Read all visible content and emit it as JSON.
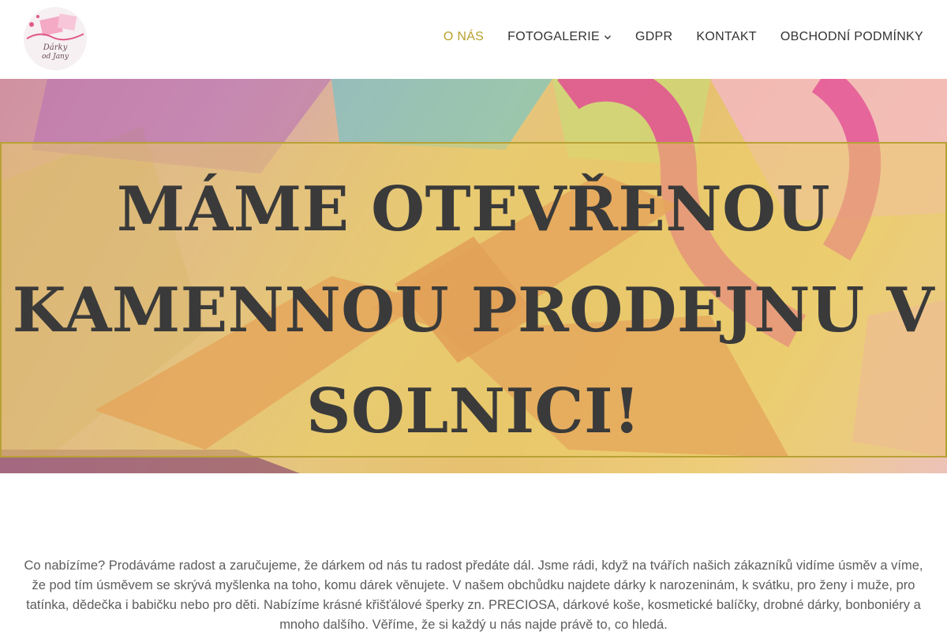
{
  "logo": {
    "line1": "Dárky",
    "line2": "od Jany"
  },
  "nav": {
    "items": [
      {
        "label": "O NÁS",
        "active": true
      },
      {
        "label": "FOTOGALERIE",
        "has_dropdown": true
      },
      {
        "label": "GDPR"
      },
      {
        "label": "KONTAKT"
      },
      {
        "label": "OBCHODNÍ PODMÍNKY"
      }
    ]
  },
  "hero": {
    "title": "MÁME OTEVŘENOU KAMENNOU PRODEJNU V SOLNICI!"
  },
  "content": {
    "paragraph": "Co nabízíme? Prodáváme radost a zaručujeme, že dárkem od nás tu radost předáte dál. Jsme rádi, když na tvářích našich zákazníků vidíme úsměv a víme, že pod tím úsměvem se skrývá myšlenka na toho, komu dárek věnujete. V našem obchůdku najdete dárky k narozeninám, k svátku, pro ženy i muže, pro tatínka, dědečka i babičku nebo pro děti. Nabízíme krásné křišťálové šperky zn. PRECIOSA, dárkové koše, kosmetické balíčky, drobné dárky, bonboniéry a mnoho dalšího. Věříme, že si každý u nás najde právě to, co hledá."
  },
  "colors": {
    "accent": "#b7a12d",
    "nav_text": "#333333",
    "hero_overlay": "#e9cd68",
    "title_text": "#3a3a3a"
  }
}
